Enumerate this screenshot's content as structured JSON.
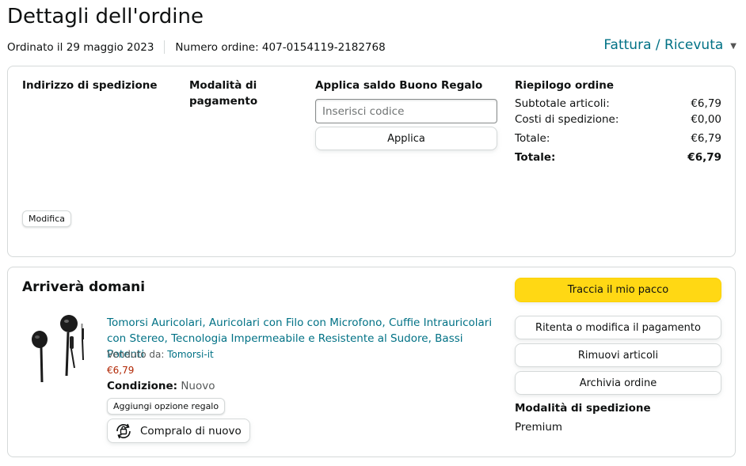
{
  "header": {
    "title": "Dettagli dell'ordine",
    "ordered_on": "Ordinato il 29 maggio 2023",
    "order_number": "Numero ordine: 407-0154119-2182768",
    "invoice_link": "Fattura / Ricevuta"
  },
  "info": {
    "shipping_address_heading": "Indirizzo di spedizione",
    "payment_method_heading_line1": "Modalità di",
    "payment_method_heading_line2": "pagamento",
    "gift_heading": "Applica saldo Buono Regalo",
    "gift_placeholder": "Inserisci codice",
    "apply_label": "Applica",
    "modify_label": "Modifica",
    "summary": {
      "heading": "Riepilogo ordine",
      "rows": [
        {
          "label": "Subtotale articoli:",
          "value": "€6,79"
        },
        {
          "label": "Costi di spedizione:",
          "value": "€0,00"
        },
        {
          "label": "Totale:",
          "value": "€6,79"
        },
        {
          "label": "Totale:",
          "value": "€6,79"
        }
      ]
    }
  },
  "shipment": {
    "title": "Arriverà domani",
    "product": {
      "title": "Tomorsi Auricolari, Auricolari con Filo con Microfono, Cuffie Intrauricolari con Stereo, Tecnologia Impermeabile e Resistente al Sudore, Bassi Potenti",
      "sold_by_label": "Venduto da:",
      "seller": "Tomorsi-it",
      "price": "€6,79",
      "condition_label": "Condizione:",
      "condition_value": "Nuovo",
      "gift_option_label": "Aggiungi opzione regalo",
      "buy_again_label": "Compralo di nuovo"
    },
    "actions": {
      "track": "Traccia il mio pacco",
      "retry_payment": "Ritenta o modifica il pagamento",
      "remove_items": "Rimuovi articoli",
      "archive_order": "Archivia ordine"
    },
    "shipping_mode_heading": "Modalità di spedizione",
    "shipping_mode_value": "Premium"
  },
  "icons": {
    "chevron": "chevron-down-icon",
    "buy_again": "buy-again-icon",
    "product": "earphones-image"
  },
  "colors": {
    "link": "#007185",
    "price": "#b12704",
    "track_button": "#ffd814",
    "border": "#d5d9d9"
  }
}
